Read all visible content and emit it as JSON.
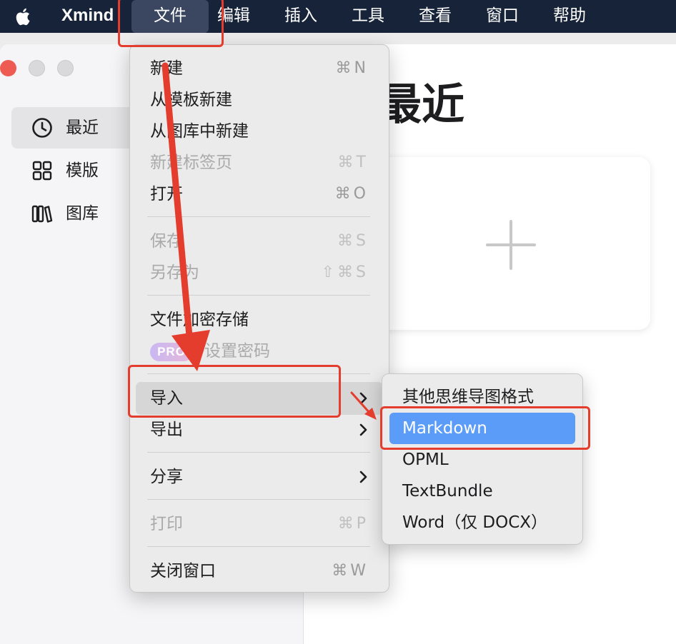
{
  "menubar": {
    "app_name": "Xmind",
    "items": [
      "文件",
      "编辑",
      "插入",
      "工具",
      "查看",
      "窗口",
      "帮助"
    ]
  },
  "sidebar": {
    "items": [
      {
        "label": "最近",
        "icon": "clock-icon"
      },
      {
        "label": "模版",
        "icon": "grid-icon"
      },
      {
        "label": "图库",
        "icon": "books-icon"
      }
    ]
  },
  "main": {
    "title": "最近",
    "new_card_icon": "plus-icon"
  },
  "file_menu": {
    "items": [
      {
        "label": "新建",
        "shortcut": "⌘N",
        "enabled": true
      },
      {
        "label": "从模板新建",
        "shortcut": "",
        "enabled": true
      },
      {
        "label": "从图库中新建",
        "shortcut": "",
        "enabled": true
      },
      {
        "label": "新建标签页",
        "shortcut": "⌘T",
        "enabled": false
      },
      {
        "label": "打开",
        "shortcut": "⌘O",
        "enabled": true
      },
      {
        "label": "保存",
        "shortcut": "⌘S",
        "enabled": false
      },
      {
        "label": "另存为",
        "shortcut": "⇧⌘S",
        "enabled": false
      },
      {
        "label": "文件加密存储",
        "shortcut": "",
        "enabled": true
      },
      {
        "label": "设置密码",
        "badge": "PRO",
        "enabled": false
      },
      {
        "label": "导入",
        "submenu": true,
        "enabled": true,
        "highlighted": true
      },
      {
        "label": "导出",
        "submenu": true,
        "enabled": true
      },
      {
        "label": "分享",
        "submenu": true,
        "enabled": true
      },
      {
        "label": "打印",
        "shortcut": "⌘P",
        "enabled": false
      },
      {
        "label": "关闭窗口",
        "shortcut": "⌘W",
        "enabled": true
      }
    ]
  },
  "import_submenu": {
    "items": [
      "其他思维导图格式",
      "Markdown",
      "OPML",
      "TextBundle",
      "Word（仅 DOCX）"
    ],
    "selected": "Markdown"
  },
  "colors": {
    "menubar_bg": "#172339",
    "selection_blue": "#5a9cf8",
    "annotation_red": "#e43d2d"
  }
}
